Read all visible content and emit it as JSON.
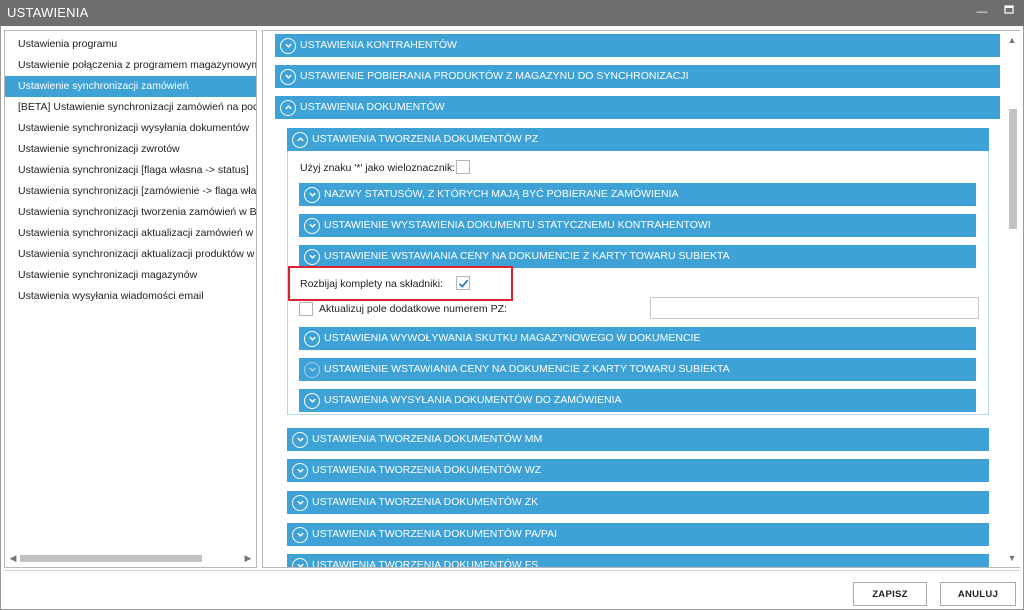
{
  "window": {
    "title": "USTAWIENIA",
    "minimize_icon": "minimize-icon",
    "maximize_icon": "maximize-icon"
  },
  "sidebar": {
    "items": [
      {
        "label": "Ustawienia programu"
      },
      {
        "label": "Ustawienie połączenia z programem magazynowym"
      },
      {
        "label": "Ustawienie synchronizacji zamówień",
        "selected": true
      },
      {
        "label": "[BETA] Ustawienie synchronizacji zamówień na podstawie"
      },
      {
        "label": "Ustawienie synchronizacji wysyłania dokumentów"
      },
      {
        "label": "Ustawienie synchronizacji zwrotów"
      },
      {
        "label": "Ustawienia synchronizacji [flaga własna -> status]"
      },
      {
        "label": "Ustawienia synchronizacji [zamówienie -> flaga własna]"
      },
      {
        "label": "Ustawienia synchronizacji tworzenia zamówień w Base"
      },
      {
        "label": "Ustawienia synchronizacji aktualizacji zamówień w Base"
      },
      {
        "label": "Ustawienia synchronizacji aktualizacji produktów w Base"
      },
      {
        "label": "Ustawienie synchronizacji magazynów"
      },
      {
        "label": "Ustawienia wysyłania wiadomości email"
      }
    ]
  },
  "main": {
    "sections": {
      "kontrahentow": "USTAWIENIA KONTRAHENTÓW",
      "pobierania": "USTAWIENIE POBIERANIA PRODUKTÓW Z MAGAZYNU DO SYNCHRONIZACJI",
      "dokumentow": "USTAWIENIA DOKUMENTÓW"
    },
    "pz": {
      "title": "USTAWIENIA TWORZENIA DOKUMENTÓW PZ",
      "wildcard_label": "Użyj znaku '*' jako wieloznacznik:",
      "wildcard_checked": false,
      "sub": {
        "statusy": "NAZWY STATUSÓW, Z KTÓRYCH MAJĄ BYĆ POBIERANE ZAMÓWIENIA",
        "kontrahent": "USTAWIENIE WYSTAWIENIA DOKUMENTU STATYCZNEMU KONTRAHENTOWI",
        "ceny": "USTAWIENIE WSTAWIANIA CENY NA DOKUMENCIE Z KARTY TOWARU SUBIEKTA",
        "skutek": "USTAWIENIA WYWOŁYWANIA SKUTKU MAGAZYNOWEGO W DOKUMENCIE",
        "ceny2": "USTAWIENIE WSTAWIANIA CENY NA DOKUMENCIE Z KARTY TOWARU SUBIEKTA",
        "wysylania": "USTAWIENIA WYSYŁANIA DOKUMENTÓW DO ZAMÓWIENIA"
      },
      "split_label": "Rozbijaj komplety na składniki:",
      "split_checked": true,
      "update_label": "Aktualizuj pole dodatkowe numerem PZ:",
      "update_checked": false,
      "update_value": ""
    },
    "other_sections": {
      "mm": "USTAWIENIA TWORZENIA DOKUMENTÓW MM",
      "wz": "USTAWIENIA TWORZENIA DOKUMENTÓW WZ",
      "zk": "USTAWIENIA TWORZENIA DOKUMENTÓW ZK",
      "pa": "USTAWIENIA TWORZENIA DOKUMENTÓW PA/PAI",
      "fs": "USTAWIENIA TWORZENIA DOKUMENTÓW FS"
    }
  },
  "footer": {
    "save": "ZAPISZ",
    "cancel": "ANULUJ"
  },
  "colors": {
    "accent": "#3ea2d6",
    "titlebar": "#6e6e6e",
    "highlight": "#d9232e"
  }
}
